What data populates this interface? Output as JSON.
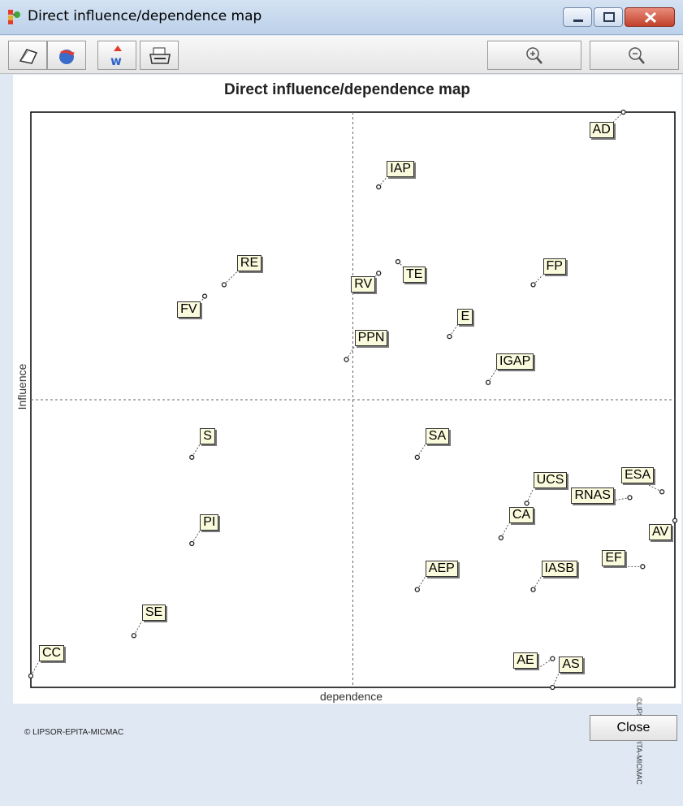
{
  "window": {
    "title": "Direct influence/dependence map"
  },
  "toolbar": {
    "buttons": [
      {
        "icon": "copy-icon"
      },
      {
        "icon": "export-icon"
      },
      {
        "icon": "web-icon"
      },
      {
        "icon": "print-icon"
      },
      {
        "icon": "zoom-in-icon"
      },
      {
        "icon": "zoom-out-icon"
      }
    ]
  },
  "chart_data": {
    "type": "scatter",
    "title": "Direct influence/dependence map",
    "xlabel": "dependence",
    "ylabel": "Influence",
    "grid": "dashed center crosshair",
    "points": [
      {
        "name": "AD",
        "x": 0.92,
        "y": 1.0
      },
      {
        "name": "IAP",
        "x": 0.54,
        "y": 0.87
      },
      {
        "name": "FP",
        "x": 0.78,
        "y": 0.7
      },
      {
        "name": "RE",
        "x": 0.3,
        "y": 0.7
      },
      {
        "name": "TE",
        "x": 0.57,
        "y": 0.74
      },
      {
        "name": "RV",
        "x": 0.54,
        "y": 0.72
      },
      {
        "name": "FV",
        "x": 0.27,
        "y": 0.68
      },
      {
        "name": "E",
        "x": 0.65,
        "y": 0.61
      },
      {
        "name": "PPN",
        "x": 0.49,
        "y": 0.57
      },
      {
        "name": "IGAP",
        "x": 0.71,
        "y": 0.53
      },
      {
        "name": "SA",
        "x": 0.6,
        "y": 0.4
      },
      {
        "name": "S",
        "x": 0.25,
        "y": 0.4
      },
      {
        "name": "ESA",
        "x": 0.98,
        "y": 0.34
      },
      {
        "name": "RNAS",
        "x": 0.93,
        "y": 0.33
      },
      {
        "name": "UCS",
        "x": 0.77,
        "y": 0.32
      },
      {
        "name": "AV",
        "x": 1.0,
        "y": 0.29
      },
      {
        "name": "CA",
        "x": 0.73,
        "y": 0.26
      },
      {
        "name": "PI",
        "x": 0.25,
        "y": 0.25
      },
      {
        "name": "EF",
        "x": 0.95,
        "y": 0.21
      },
      {
        "name": "IASB",
        "x": 0.78,
        "y": 0.17
      },
      {
        "name": "AEP",
        "x": 0.6,
        "y": 0.17
      },
      {
        "name": "SE",
        "x": 0.16,
        "y": 0.09
      },
      {
        "name": "CC",
        "x": 0.0,
        "y": 0.02
      },
      {
        "name": "AE",
        "x": 0.81,
        "y": 0.05
      },
      {
        "name": "AS",
        "x": 0.81,
        "y": 0.0
      }
    ]
  },
  "watermark": "©LIPSOR-EPITA-MICMAC",
  "footer": {
    "credit": "© LIPSOR-EPITA-MICMAC",
    "close_label": "Close"
  }
}
